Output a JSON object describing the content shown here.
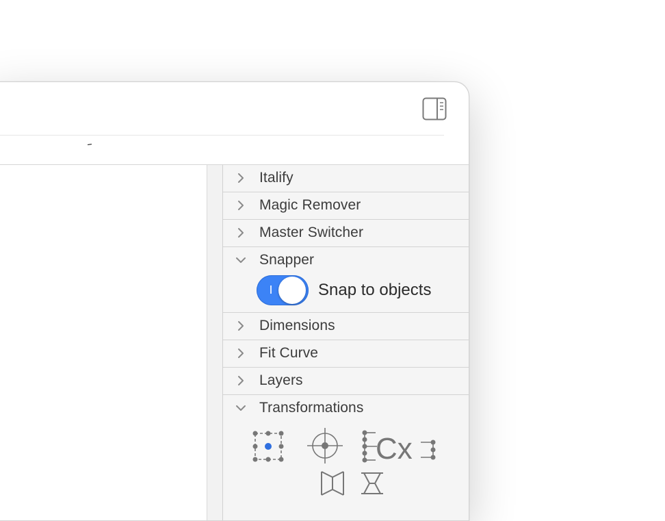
{
  "window": {
    "toolbar": {
      "sidebar_toggle_icon": "sidebar-right-icon"
    },
    "tab_glyph": "-"
  },
  "panel": {
    "sections": [
      {
        "title": "Italify",
        "expanded": false
      },
      {
        "title": "Magic Remover",
        "expanded": false
      },
      {
        "title": "Master Switcher",
        "expanded": false
      },
      {
        "title": "Snapper",
        "expanded": true
      },
      {
        "title": "Dimensions",
        "expanded": false
      },
      {
        "title": "Fit Curve",
        "expanded": false
      },
      {
        "title": "Layers",
        "expanded": false
      },
      {
        "title": "Transformations",
        "expanded": true
      }
    ],
    "snapper": {
      "toggle_on": true,
      "toggle_mark": "I",
      "toggle_label": "Snap to objects"
    },
    "transformations": {
      "icons": [
        "bounding-box-origin-icon",
        "crosshair-origin-icon",
        "center-x-align-icon",
        "flip-horizontal-icon",
        "flip-vertical-icon"
      ],
      "cx_label": "Cx"
    }
  },
  "colors": {
    "accent": "#3c83f6",
    "panel_bg": "#f5f5f5",
    "divider": "#d3d3d3",
    "text": "#3c3c3c",
    "icon": "#777777"
  }
}
